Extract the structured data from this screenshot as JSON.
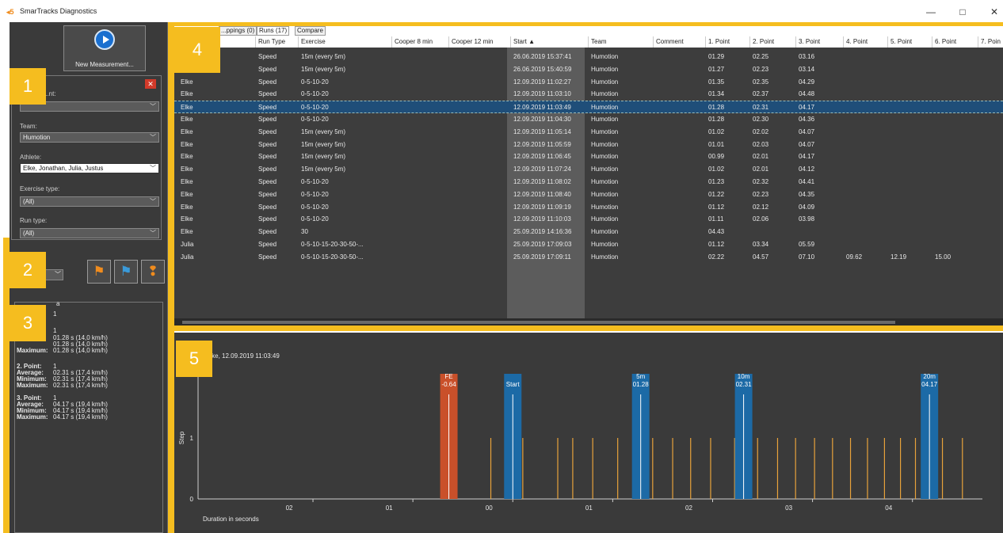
{
  "window": {
    "title": "SmarTracks Diagnostics",
    "logo": "◂5",
    "minimize": "—",
    "maximize": "□",
    "close": "✕"
  },
  "sidebar": {
    "new_measurement": "New Measurement...",
    "filters": {
      "measurement_label": "...nt:",
      "team_label": "Team:",
      "team_value": "Humotion",
      "athlete_label": "Athlete:",
      "athlete_value": "Elke, Jonathan, Julia, Justus",
      "exercise_type_label": "Exercise type:",
      "exercise_type_value": "(All)",
      "run_type_label": "Run type:",
      "run_type_value": "(All)"
    },
    "mode_value": "e",
    "stats": {
      "header": "a",
      "count_top": "1",
      "p1_count": "1",
      "p1_avg": "01.28 s (14,0 km/h)",
      "p1_min": "01.28 s (14,0 km/h)",
      "p1_max": "01.28 s (14,0 km/h)",
      "max_label": "Maximum:",
      "p2_label": "2. Point:",
      "p2_count": "1",
      "avg_label": "Average:",
      "min_label": "Minimum:",
      "p2_avg": "02.31 s (17,4 km/h)",
      "p2_min": "02.31 s (17,4 km/h)",
      "p2_max": "02.31 s (17,4 km/h)",
      "p3_label": "3. Point:",
      "p3_count": "1",
      "p3_avg": "04.17 s (19,4 km/h)",
      "p3_min": "04.17 s (19,4 km/h)",
      "p3_max": "04.17 s (19,4 km/h)"
    }
  },
  "tabs": [
    "...ppings (0)",
    "Runs (17)",
    "Compare"
  ],
  "table": {
    "columns": [
      "Run Type",
      "Exercise",
      "Cooper 8 min",
      "Cooper 12 min",
      "Start ▲",
      "Team",
      "Comment",
      "1. Point",
      "2. Point",
      "3. Point",
      "4. Point",
      "5. Point",
      "6. Point",
      "7. Poin"
    ],
    "rows": [
      {
        "athlete": "",
        "run_type": "Speed",
        "exercise": "15m (every 5m)",
        "start": "26.06.2019 15:37:41",
        "team": "Humotion",
        "p": [
          "01.29",
          "02.25",
          "03.16",
          "",
          "",
          ""
        ]
      },
      {
        "athlete": "",
        "run_type": "Speed",
        "exercise": "15m (every 5m)",
        "start": "26.06.2019 15:40:59",
        "team": "Humotion",
        "p": [
          "01.27",
          "02.23",
          "03.14",
          "",
          "",
          ""
        ]
      },
      {
        "athlete": "Elke",
        "run_type": "Speed",
        "exercise": "0-5-10-20",
        "start": "12.09.2019 11:02:27",
        "team": "Humotion",
        "p": [
          "01.35",
          "02.35",
          "04.29",
          "",
          "",
          ""
        ]
      },
      {
        "athlete": "Elke",
        "run_type": "Speed",
        "exercise": "0-5-10-20",
        "start": "12.09.2019 11:03:10",
        "team": "Humotion",
        "p": [
          "01.34",
          "02.37",
          "04.48",
          "",
          "",
          ""
        ]
      },
      {
        "athlete": "Elke",
        "run_type": "Speed",
        "exercise": "0-5-10-20",
        "start": "12.09.2019 11:03:49",
        "team": "Humotion",
        "p": [
          "01.28",
          "02.31",
          "04.17",
          "",
          "",
          ""
        ]
      },
      {
        "athlete": "Elke",
        "run_type": "Speed",
        "exercise": "0-5-10-20",
        "start": "12.09.2019 11:04:30",
        "team": "Humotion",
        "p": [
          "01.28",
          "02.30",
          "04.36",
          "",
          "",
          ""
        ]
      },
      {
        "athlete": "Elke",
        "run_type": "Speed",
        "exercise": "15m (every 5m)",
        "start": "12.09.2019 11:05:14",
        "team": "Humotion",
        "p": [
          "01.02",
          "02.02",
          "04.07",
          "",
          "",
          ""
        ]
      },
      {
        "athlete": "Elke",
        "run_type": "Speed",
        "exercise": "15m (every 5m)",
        "start": "12.09.2019 11:05:59",
        "team": "Humotion",
        "p": [
          "01.01",
          "02.03",
          "04.07",
          "",
          "",
          ""
        ]
      },
      {
        "athlete": "Elke",
        "run_type": "Speed",
        "exercise": "15m (every 5m)",
        "start": "12.09.2019 11:06:45",
        "team": "Humotion",
        "p": [
          "00.99",
          "02.01",
          "04.17",
          "",
          "",
          ""
        ]
      },
      {
        "athlete": "Elke",
        "run_type": "Speed",
        "exercise": "15m (every 5m)",
        "start": "12.09.2019 11:07:24",
        "team": "Humotion",
        "p": [
          "01.02",
          "02.01",
          "04.12",
          "",
          "",
          ""
        ]
      },
      {
        "athlete": "Elke",
        "run_type": "Speed",
        "exercise": "0-5-10-20",
        "start": "12.09.2019 11:08:02",
        "team": "Humotion",
        "p": [
          "01.23",
          "02.32",
          "04.41",
          "",
          "",
          ""
        ]
      },
      {
        "athlete": "Elke",
        "run_type": "Speed",
        "exercise": "0-5-10-20",
        "start": "12.09.2019 11:08:40",
        "team": "Humotion",
        "p": [
          "01.22",
          "02.23",
          "04.35",
          "",
          "",
          ""
        ]
      },
      {
        "athlete": "Elke",
        "run_type": "Speed",
        "exercise": "0-5-10-20",
        "start": "12.09.2019 11:09:19",
        "team": "Humotion",
        "p": [
          "01.12",
          "02.12",
          "04.09",
          "",
          "",
          ""
        ]
      },
      {
        "athlete": "Elke",
        "run_type": "Speed",
        "exercise": "0-5-10-20",
        "start": "12.09.2019 11:10:03",
        "team": "Humotion",
        "p": [
          "01.11",
          "02.06",
          "03.98",
          "",
          "",
          ""
        ]
      },
      {
        "athlete": "Elke",
        "run_type": "Speed",
        "exercise": "30",
        "start": "25.09.2019 14:16:36",
        "team": "Humotion",
        "p": [
          "04.43",
          "",
          "",
          "",
          "",
          ""
        ]
      },
      {
        "athlete": "Julia",
        "run_type": "Speed",
        "exercise": "0-5-10-15-20-30-50-...",
        "start": "25.09.2019 17:09:03",
        "team": "Humotion",
        "p": [
          "01.12",
          "03.34",
          "05.59",
          "",
          "",
          ""
        ]
      },
      {
        "athlete": "Julia",
        "run_type": "Speed",
        "exercise": "0-5-10-15-20-30-50-...",
        "start": "25.09.2019 17:09:11",
        "team": "Humotion",
        "p": [
          "02.22",
          "04.57",
          "07.10",
          "09.62",
          "12.19",
          "15.00"
        ]
      }
    ],
    "selected_index": 4
  },
  "chart": {
    "title": "Elke, 12.09.2019 11:03:49",
    "ylabel": "Step",
    "xlabel": "Duration in seconds",
    "y_ticks": [
      "0",
      "1"
    ],
    "x_ticks": [
      "02",
      "01",
      "00",
      "01",
      "02",
      "03",
      "04"
    ]
  },
  "chart_data": {
    "type": "bar",
    "x_domain": [
      -3.15,
      4.7
    ],
    "x_ticks": [
      -2,
      -1,
      0,
      1,
      2,
      3,
      4
    ],
    "x_tick_labels": [
      "02",
      "01",
      "00",
      "01",
      "02",
      "03",
      "04"
    ],
    "ylim": [
      0,
      1
    ],
    "markers": [
      {
        "x": -0.64,
        "label": "FE",
        "value_label": "-0.64",
        "color": "#c9502a"
      },
      {
        "x": 0,
        "label": "Start",
        "value_label": "",
        "color": "#1c6aa6"
      },
      {
        "x": 1.28,
        "label": "5m",
        "value_label": "01.28",
        "color": "#1c6aa6"
      },
      {
        "x": 2.31,
        "label": "10m",
        "value_label": "02.31",
        "color": "#1c6aa6"
      },
      {
        "x": 4.17,
        "label": "20m",
        "value_label": "04.17",
        "color": "#1c6aa6"
      }
    ],
    "steps": [
      -0.22,
      0.1,
      0.45,
      0.6,
      0.8,
      1.05,
      1.4,
      1.6,
      1.78,
      1.98,
      2.22,
      2.45,
      2.65,
      2.83,
      3.02,
      3.2,
      3.38,
      3.55,
      3.72,
      3.88,
      4.03,
      4.3,
      4.5
    ],
    "step_color": "#e8a23a"
  },
  "callouts": [
    "1",
    "2",
    "3",
    "4",
    "5"
  ],
  "accent": "#f5bd1f"
}
